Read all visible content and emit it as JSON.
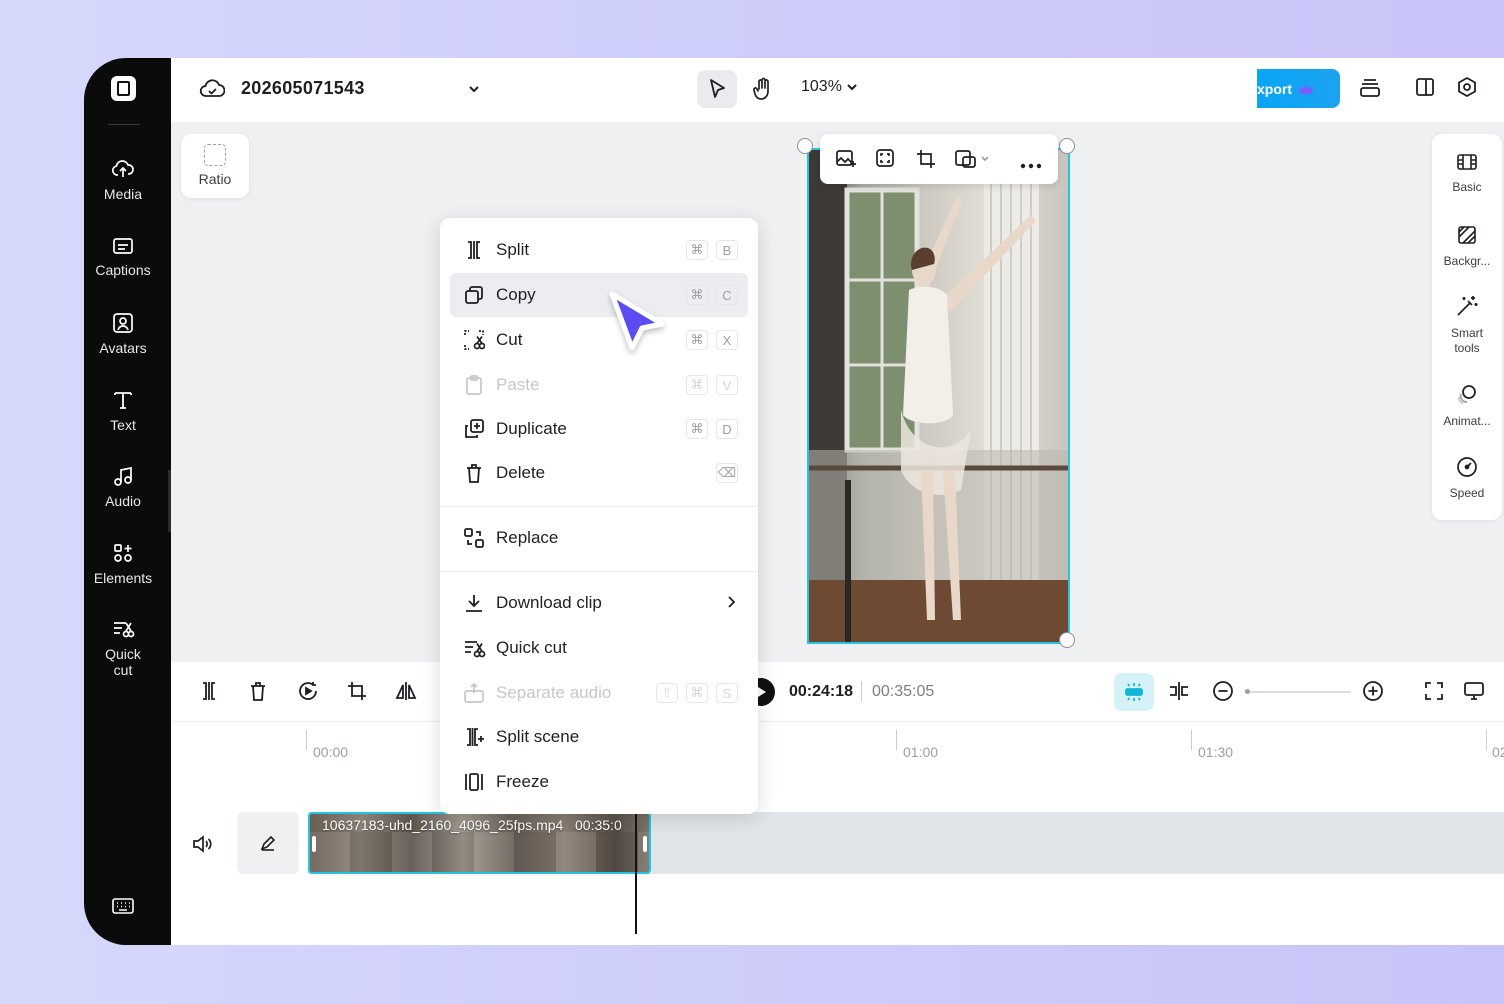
{
  "sidebar": {
    "items": [
      {
        "label": "Media",
        "icon": "cloud-upload-icon"
      },
      {
        "label": "Captions",
        "icon": "captions-icon"
      },
      {
        "label": "Avatars",
        "icon": "avatar-icon"
      },
      {
        "label": "Text",
        "icon": "text-icon"
      },
      {
        "label": "Audio",
        "icon": "music-note-icon"
      },
      {
        "label": "Elements",
        "icon": "elements-icon"
      },
      {
        "label": "Quick",
        "label2": "cut",
        "icon": "quick-cut-icon"
      }
    ]
  },
  "header": {
    "project_name": "202605071543",
    "zoom": "103%",
    "export_label": "xport"
  },
  "canvas": {
    "ratio_label": "Ratio"
  },
  "right_panel": {
    "items": [
      {
        "label": "Basic"
      },
      {
        "label": "Backgr..."
      },
      {
        "label": "Smart",
        "label2": "tools"
      },
      {
        "label": "Animat..."
      },
      {
        "label": "Speed"
      }
    ]
  },
  "context_menu": {
    "items": [
      {
        "label": "Split",
        "keys": [
          "⌘",
          "B"
        ]
      },
      {
        "label": "Copy",
        "keys": [
          "⌘",
          "C"
        ]
      },
      {
        "label": "Cut",
        "keys": [
          "⌘",
          "X"
        ]
      },
      {
        "label": "Paste",
        "keys": [
          "⌘",
          "V"
        ]
      },
      {
        "label": "Duplicate",
        "keys": [
          "⌘",
          "D"
        ]
      },
      {
        "label": "Delete",
        "keys": [
          "⌫"
        ]
      },
      {
        "label": "Replace"
      },
      {
        "label": "Download clip"
      },
      {
        "label": "Quick cut"
      },
      {
        "label": "Separate audio",
        "keys": [
          "⇧",
          "⌘",
          "S"
        ]
      },
      {
        "label": "Split scene"
      },
      {
        "label": "Freeze"
      }
    ]
  },
  "timeline": {
    "current_time": "00:24:18",
    "total_time": "00:35:05",
    "ruler_labels": [
      "00:00",
      "01:00",
      "01:30",
      "02"
    ],
    "clip_name": "10637183-uhd_2160_4096_25fps.mp4",
    "clip_duration": "00:35:0"
  },
  "colors": {
    "accent": "#22c5e6",
    "cursor": "#5b4cf0",
    "export": "#0aa5f5"
  }
}
